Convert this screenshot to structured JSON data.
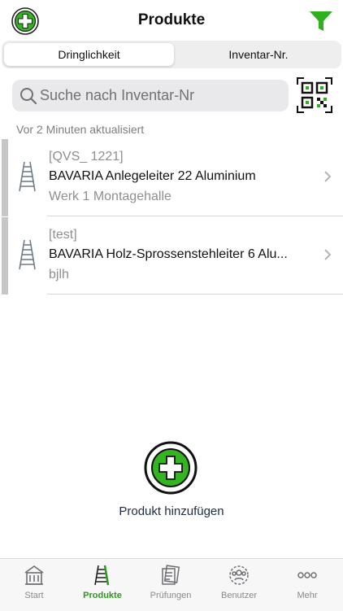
{
  "header": {
    "title": "Produkte",
    "logo_icon": "green-cross-logo-icon",
    "filter_icon": "funnel-filter-icon",
    "accent_color": "#33b51f"
  },
  "segments": [
    {
      "label": "Dringlichkeit",
      "selected": true
    },
    {
      "label": "Inventar-Nr.",
      "selected": false
    }
  ],
  "search": {
    "placeholder": "Suche nach Inventar-Nr",
    "value": "",
    "qr_icon": "qr-code-scan-icon"
  },
  "status": {
    "updated_text": "Vor 2 Minuten aktualisiert"
  },
  "products": [
    {
      "inventory": "[QVS_ 1221]",
      "name": "BAVARIA Anlegeleiter 22 Aluminium",
      "location": "Werk 1 Montagehalle",
      "icon": "ladder-thumbnail-icon"
    },
    {
      "inventory": "[test]",
      "name": "BAVARIA Holz-Sprossenstehleiter 6 Alu...",
      "location": "bjlh",
      "icon": "ladder-thumbnail-icon"
    }
  ],
  "add_product": {
    "label": "Produkt hinzufügen",
    "icon": "add-plus-icon"
  },
  "tabbar": [
    {
      "label": "Start",
      "icon": "home-building-icon",
      "active": false
    },
    {
      "label": "Produkte",
      "icon": "ladder-icon",
      "active": true
    },
    {
      "label": "Prüfungen",
      "icon": "inspection-documents-icon",
      "active": false
    },
    {
      "label": "Benutzer",
      "icon": "users-group-icon",
      "active": false
    },
    {
      "label": "Mehr",
      "icon": "more-dots-icon",
      "active": false
    }
  ]
}
